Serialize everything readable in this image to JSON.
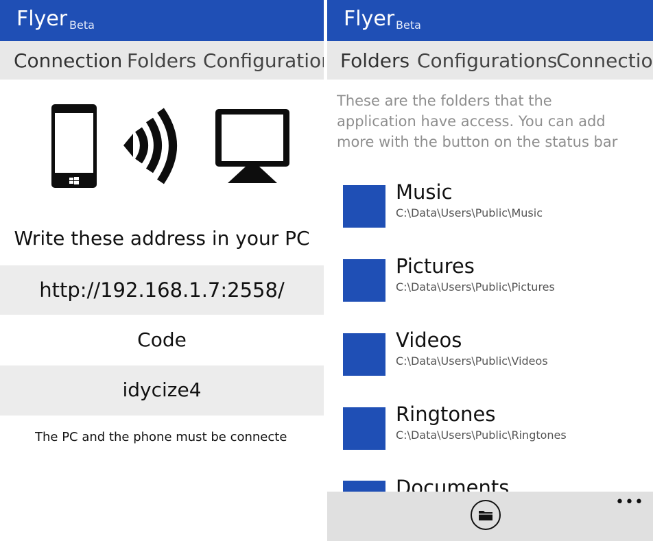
{
  "app": {
    "name": "Flyer",
    "badge": "Beta"
  },
  "colors": {
    "accent": "#1f4fb5",
    "tabbar_bg": "#e8e8e8",
    "band_bg": "#ececec",
    "appbar_bg": "#e0e0e0"
  },
  "left": {
    "tabs": [
      "Connection",
      "Folders",
      "Configurations"
    ],
    "illustration_icons": [
      "phone-icon",
      "wireless-signal-icon",
      "monitor-icon"
    ],
    "instruction": "Write these address in your PC",
    "address": "http://192.168.1.7:2558/",
    "code_label": "Code",
    "code_value": "idycize4",
    "note": "The PC and the phone must be connecte"
  },
  "right": {
    "tabs": [
      "Folders",
      "Configurations",
      "Connection"
    ],
    "intro_lines": [
      "These are the folders that the",
      "application have access. You can add",
      "more with the button on the status bar"
    ],
    "folders": [
      {
        "name": "Music",
        "path": "C:\\Data\\Users\\Public\\Music"
      },
      {
        "name": "Pictures",
        "path": "C:\\Data\\Users\\Public\\Pictures"
      },
      {
        "name": "Videos",
        "path": "C:\\Data\\Users\\Public\\Videos"
      },
      {
        "name": "Ringtones",
        "path": "C:\\Data\\Users\\Public\\Ringtones"
      },
      {
        "name": "Documents",
        "path": ""
      }
    ],
    "appbar": {
      "button_icon": "folder-icon",
      "more_label": "•••"
    }
  }
}
